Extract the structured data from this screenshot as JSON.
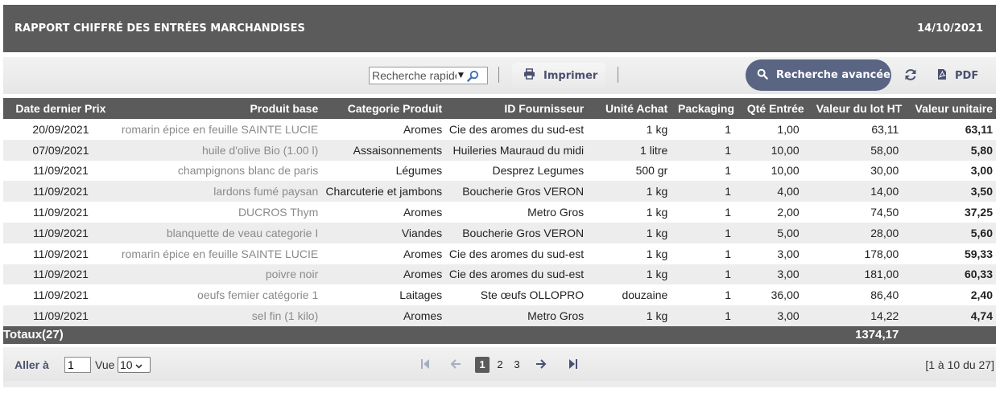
{
  "header": {
    "title": "RAPPORT CHIFFRÉ DES ENTRÉES MARCHANDISES",
    "date": "14/10/2021"
  },
  "toolbar": {
    "search_placeholder": "Recherche rapide",
    "print_label": "Imprimer",
    "advanced_search_label": "Recherche avancée",
    "pdf_label": "PDF"
  },
  "table": {
    "columns": [
      "Date dernier Prix",
      "Produit base",
      "Categorie Produit",
      "ID Fournisseur",
      "Unité Achat",
      "Packaging",
      "Qté Entrée",
      "Valeur du lot HT",
      "Valeur unitaire"
    ],
    "rows": [
      [
        "20/09/2021",
        "romarin épice en feuille SAINTE LUCIE",
        "Aromes",
        "Cie des aromes du sud-est",
        "1 kg",
        "1",
        "1,00",
        "63,11",
        "63,11"
      ],
      [
        "07/09/2021",
        "huile d'olive Bio (1.00 l)",
        "Assaisonnements",
        "Huileries Mauraud du midi",
        "1 litre",
        "1",
        "10,00",
        "58,00",
        "5,80"
      ],
      [
        "11/09/2021",
        "champignons blanc de paris",
        "Légumes",
        "Desprez Legumes",
        "500 gr",
        "1",
        "10,00",
        "30,00",
        "3,00"
      ],
      [
        "11/09/2021",
        "lardons fumé paysan",
        "Charcuterie et jambons",
        "Boucherie Gros VERON",
        "1 kg",
        "1",
        "4,00",
        "14,00",
        "3,50"
      ],
      [
        "11/09/2021",
        "DUCROS Thym",
        "Aromes",
        "Metro Gros",
        "1 kg",
        "1",
        "2,00",
        "74,50",
        "37,25"
      ],
      [
        "11/09/2021",
        "blanquette de veau categorie I",
        "Viandes",
        "Boucherie Gros VERON",
        "1 kg",
        "1",
        "5,00",
        "28,00",
        "5,60"
      ],
      [
        "11/09/2021",
        "romarin épice en feuille SAINTE LUCIE",
        "Aromes",
        "Cie des aromes du sud-est",
        "1 kg",
        "1",
        "3,00",
        "178,00",
        "59,33"
      ],
      [
        "11/09/2021",
        "poivre noir",
        "Aromes",
        "Cie des aromes du sud-est",
        "1 kg",
        "1",
        "3,00",
        "181,00",
        "60,33"
      ],
      [
        "11/09/2021",
        "oeufs femier catégorie 1",
        "Laitages",
        "Ste œufs OLLOPRO",
        "douzaine",
        "1",
        "36,00",
        "86,40",
        "2,40"
      ],
      [
        "11/09/2021",
        "sel fin (1 kilo)",
        "Aromes",
        "Metro Gros",
        "1 kg",
        "1",
        "3,00",
        "14,22",
        "4,74"
      ]
    ],
    "totals_label": "Totaux(27)",
    "totals_value": "1374,17"
  },
  "pager": {
    "goto_label": "Aller à",
    "goto_value": "1",
    "view_label": "Vue",
    "page_size": "10",
    "pages": [
      "1",
      "2",
      "3"
    ],
    "current_page": "1",
    "range_text": "[1 à 10 du 27]"
  },
  "icons": {
    "search": "magnifier-icon",
    "print": "printer-icon",
    "refresh": "refresh-icon",
    "pdf": "pdf-file-icon",
    "first": "first-page-icon",
    "prev": "prev-page-icon",
    "next": "next-page-icon",
    "last": "last-page-icon"
  },
  "colors": {
    "header_bg": "#5b5b5b",
    "accent_button": "#5a6584",
    "toolbar_text": "#4a5070",
    "row_alt": "#ededed"
  }
}
